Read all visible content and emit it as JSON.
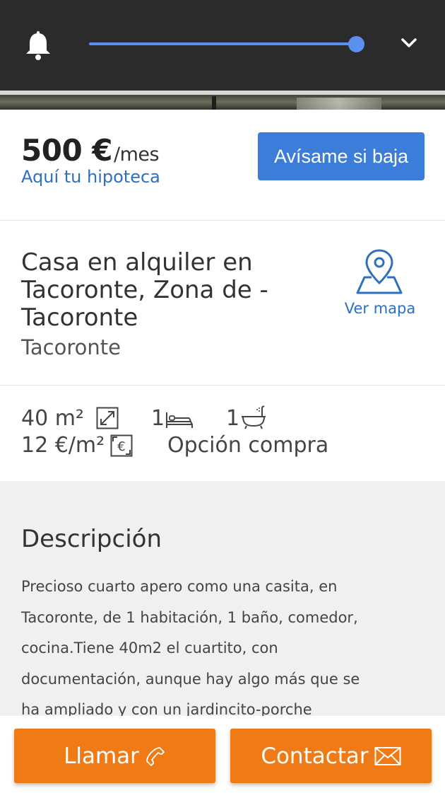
{
  "price": {
    "amount": "500 €",
    "unit": "/mes",
    "mortgage_link": "Aquí tu hipoteca",
    "alert_button": "Avísame si baja"
  },
  "listing": {
    "title_lines": [
      "Casa en alquiler en",
      "Tacoronte, Zona de -",
      "Tacoronte"
    ],
    "zone": "Tacoronte",
    "map_link": "Ver mapa"
  },
  "features": {
    "area": "40 m²",
    "bedrooms": "1",
    "bathrooms": "1",
    "price_per_m2": "12 €/m²",
    "purchase_option": "Opción compra"
  },
  "description": {
    "heading": "Descripción",
    "lines": [
      "Precioso cuarto apero como una casita, en",
      "Tacoronte, de 1 habitación, 1 baño, comedor,",
      "cocina.Tiene 40m2 el cuartito, con",
      "documentación, aunque hay algo más que se",
      "ha ampliado y con un jardincito-porche"
    ]
  },
  "actions": {
    "call": "Llamar",
    "contact": "Contactar"
  },
  "colors": {
    "accent_blue": "#3b7dd8",
    "link_blue": "#2e6fbf",
    "cta_orange": "#f07a16",
    "topbar": "#2b2b2b"
  },
  "icons": [
    "bell-icon",
    "chevron-down-icon",
    "map-pin-icon",
    "area-icon",
    "bed-icon",
    "bath-icon",
    "euro-icon",
    "phone-icon",
    "mail-icon"
  ]
}
